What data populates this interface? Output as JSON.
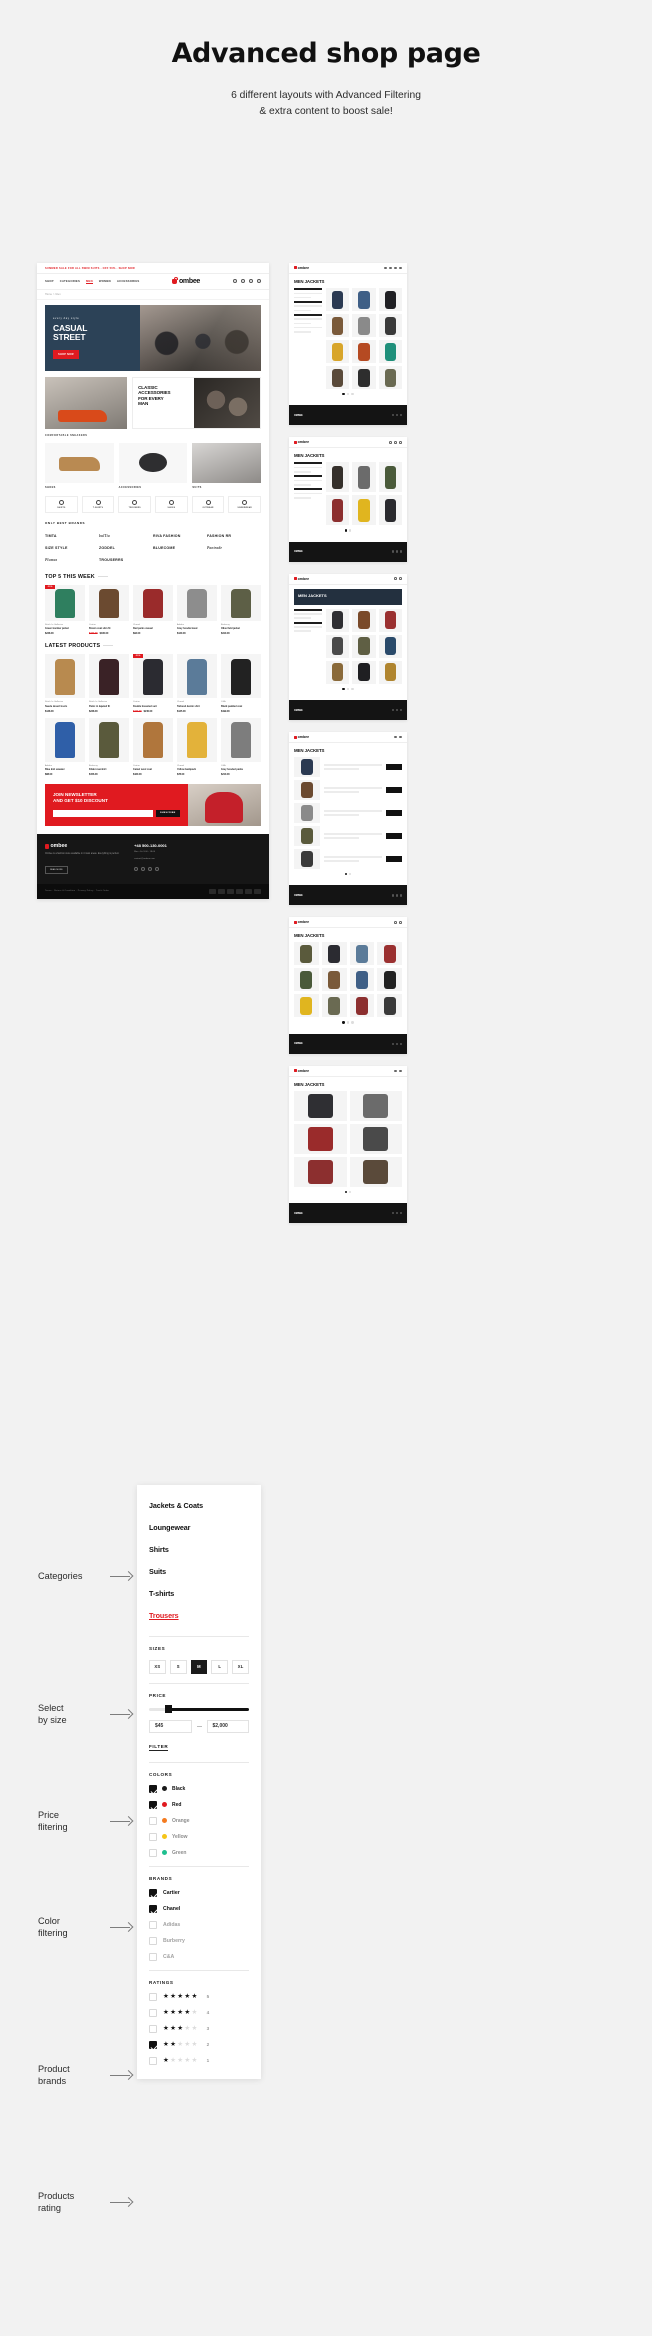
{
  "header": {
    "title": "Advanced shop page",
    "subtitle_line1": "6 different layouts with Advanced Filtering",
    "subtitle_line2": "& extra content to boost sale!"
  },
  "annotations": [
    {
      "label_line1": "Categories",
      "label_line2": ""
    },
    {
      "label_line1": "Select",
      "label_line2": "by size"
    },
    {
      "label_line1": "Price",
      "label_line2": "flitering"
    },
    {
      "label_line1": "Color",
      "label_line2": "filtering"
    },
    {
      "label_line1": "Product",
      "label_line2": "brands"
    },
    {
      "label_line1": "Products",
      "label_line2": "rating"
    }
  ],
  "shop": {
    "promo": "SUMMER SALE FOR ALL SWIM SUITS - OFF 50% - SHOP NOW",
    "brand": "ombee",
    "nav": [
      "SHOP",
      "CATEGORIES",
      "MEN",
      "WOMEN",
      "ACCESSORIES"
    ],
    "breadcrumb": "Home  >  Men",
    "icons": [
      "search-icon",
      "user-icon",
      "heart-icon",
      "cart-icon"
    ],
    "hero": {
      "eyebrow": "every day style",
      "heading_line1": "CASUAL",
      "heading_line2": "STREET",
      "button": "SHOP NOW"
    },
    "dual_banner": {
      "caption": "COMFORTABLE SNEAKERS",
      "heading_line1": "CLASSIC",
      "heading_line2": "ACCESSORIES",
      "heading_line3": "FOR EVERY",
      "heading_line4": "MAN"
    },
    "tiles": [
      {
        "label": "SHOES"
      },
      {
        "label": "ACCESSORIES"
      },
      {
        "label": "SUITS"
      }
    ],
    "category_circles": [
      {
        "label": "SHIRTS",
        "icon": "shirt-icon"
      },
      {
        "label": "T-SHIRTS",
        "icon": "tshirt-icon"
      },
      {
        "label": "TROUSERS",
        "icon": "trousers-icon"
      },
      {
        "label": "SHOES",
        "icon": "shoe-icon"
      },
      {
        "label": "OUTWEAR",
        "icon": "coat-icon"
      },
      {
        "label": "UNDERWEAR",
        "icon": "underwear-icon"
      }
    ],
    "brands_title": "ONLY BEST BRANDS",
    "brand_logos": [
      "TIMTA",
      "bulTia",
      "RIVA FASHION",
      "FASHION RR",
      "SIZE STYLE",
      "ZODDEL",
      "BLUECOME",
      "Pantrade",
      "Plumas",
      "TROUSERRS"
    ],
    "top5_title": "TOP 5 THIS WEEK",
    "latest_title": "LATEST PRODUCTS",
    "top5_products": [
      {
        "vendor": "Stitch In Galleries",
        "title": "Green bomber jacket",
        "price": "$248.00",
        "old_price": ""
      },
      {
        "vendor": "Cartier",
        "title": "Brown coat slim fit",
        "price": "$180.00",
        "old_price": "$240.00"
      },
      {
        "vendor": "Chanel",
        "title": "Red pants casual",
        "price": "$92.00",
        "old_price": ""
      },
      {
        "vendor": "Adidas",
        "title": "Grey hoodie basic",
        "price": "$120.00",
        "old_price": ""
      },
      {
        "vendor": "Burberry",
        "title": "Olive field jacket",
        "price": "$310.00",
        "old_price": ""
      }
    ],
    "latest_products_row1": [
      {
        "vendor": "Stitch In Galleries",
        "title": "Suede desert boots",
        "price": "$148.00",
        "old_price": ""
      },
      {
        "vendor": "Stitch In Galleries",
        "title": "Panic in lapeled fit",
        "price": "$248.00",
        "old_price": ""
      },
      {
        "vendor": "Cartier",
        "title": "Double breasted suit",
        "price": "$240.00",
        "old_price": "$160.00"
      },
      {
        "vendor": "Chanel",
        "title": "Tailored denim shirt",
        "price": "$125.00",
        "old_price": ""
      },
      {
        "vendor": "C&A",
        "title": "Black padded coat",
        "price": "$199.00",
        "old_price": ""
      }
    ],
    "latest_products_row2": [
      {
        "vendor": "Adidas",
        "title": "Blue knit sweater",
        "price": "$88.00",
        "old_price": ""
      },
      {
        "vendor": "Burberry",
        "title": "Khaki overshirt",
        "price": "$156.00",
        "old_price": ""
      },
      {
        "vendor": "Cartier",
        "title": "Camel wool coat",
        "price": "$420.00",
        "old_price": ""
      },
      {
        "vendor": "Chanel",
        "title": "Yellow backpack",
        "price": "$78.00",
        "old_price": ""
      },
      {
        "vendor": "C&A",
        "title": "Grey hooded parka",
        "price": "$210.00",
        "old_price": ""
      }
    ],
    "newsletter": {
      "heading_line1": "JOIN NEWSLETTER",
      "heading_line2": "AND GET $10 DISCOUNT",
      "placeholder": "Your e-mail address",
      "button": "SUBSCRIBE"
    },
    "footer": {
      "brand": "ombee",
      "about": "Ombee is a fashion store available in 4 main areas. Everything is perfect.",
      "button": "READ MORE",
      "phone": "+48 500-130-0001",
      "hours": "Mon - Fri 9:00 - 18:00",
      "email": "contact@ombee.com",
      "socials": [
        "facebook-icon",
        "twitter-icon",
        "instagram-icon",
        "pinterest-icon"
      ],
      "bottom_links": "Terms  ·  Return & Condition  ·  Privacy Policy  ·  Track Order",
      "payments": [
        "visa",
        "mastercard",
        "paypal",
        "amex",
        "discover",
        "maestro"
      ]
    }
  },
  "variants": [
    {
      "name": "variant-3col-sidebar",
      "title": "MEN JACKETS",
      "footer_note": "OMBEE",
      "columns": 3
    },
    {
      "name": "variant-3col-tall",
      "title": "MEN JACKETS",
      "footer_note": "OMBEE",
      "columns": 3
    },
    {
      "name": "variant-banner-top",
      "title": "MEN JACKETS",
      "footer_note": "OMBEE",
      "columns": 3
    },
    {
      "name": "variant-list-view",
      "title": "MEN JACKETS",
      "footer_note": "OMBEE",
      "columns": 1
    },
    {
      "name": "variant-4col-wide",
      "title": "MEN JACKETS",
      "footer_note": "OMBEE",
      "columns": 4
    },
    {
      "name": "variant-2col-large",
      "title": "MEN JACKETS",
      "footer_note": "OMBEE",
      "columns": 2
    }
  ],
  "filter_panel": {
    "categories": [
      {
        "label": "Jackets & Coats",
        "active": false
      },
      {
        "label": "Loungewear",
        "active": false
      },
      {
        "label": "Shirts",
        "active": false
      },
      {
        "label": "Suits",
        "active": false
      },
      {
        "label": "T-shirts",
        "active": false
      },
      {
        "label": "Trousers",
        "active": true
      }
    ],
    "sizes_label": "SIZES",
    "sizes": [
      {
        "label": "XS",
        "selected": false
      },
      {
        "label": "S",
        "selected": false
      },
      {
        "label": "M",
        "selected": true
      },
      {
        "label": "L",
        "selected": false
      },
      {
        "label": "XL",
        "selected": false
      }
    ],
    "price_label": "PRICE",
    "price_min": "$45",
    "price_max": "$2,000",
    "filter_link": "FILTER",
    "colors_label": "COLORS",
    "colors": [
      {
        "label": "Black",
        "hex": "#1a1a1a",
        "checked": true
      },
      {
        "label": "Red",
        "hex": "#e01a20",
        "checked": true
      },
      {
        "label": "Orange",
        "hex": "#f47b20",
        "checked": false
      },
      {
        "label": "Yellow",
        "hex": "#f5c518",
        "checked": false
      },
      {
        "label": "Green",
        "hex": "#1fbf8f",
        "checked": false
      }
    ],
    "brands_label": "BRANDS",
    "brands": [
      {
        "label": "Cartier",
        "checked": true
      },
      {
        "label": "Chanel",
        "checked": true
      },
      {
        "label": "Adidas",
        "checked": false
      },
      {
        "label": "Burberry",
        "checked": false
      },
      {
        "label": "C&A",
        "checked": false
      }
    ],
    "ratings_label": "RATINGS",
    "ratings": [
      {
        "stars": 5,
        "count": "5",
        "checked": false
      },
      {
        "stars": 4,
        "count": "4",
        "checked": false
      },
      {
        "stars": 3,
        "count": "3",
        "checked": false
      },
      {
        "stars": 2,
        "count": "2",
        "checked": true
      },
      {
        "stars": 1,
        "count": "1",
        "checked": false
      }
    ]
  },
  "colors": {
    "accent": "#e01a20",
    "dark": "#161616",
    "page_bg": "#f2f2f2"
  }
}
